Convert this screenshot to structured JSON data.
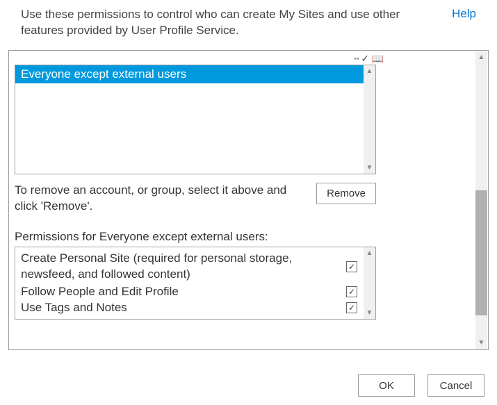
{
  "header": {
    "description": "Use these permissions to control who can create My Sites and use other features provided by User Profile Service.",
    "help_label": "Help"
  },
  "accounts": {
    "items": [
      "Everyone except external users"
    ],
    "selected_index": 0
  },
  "remove_section": {
    "instruction": "To remove an account, or group, select it above and click 'Remove'.",
    "button_label": "Remove"
  },
  "permissions": {
    "label": "Permissions for Everyone except external users:",
    "items": [
      {
        "label": "Create Personal Site (required for personal storage, newsfeed, and followed content)",
        "checked": true
      },
      {
        "label": "Follow People and Edit Profile",
        "checked": true
      },
      {
        "label": "Use Tags and Notes",
        "checked": true
      }
    ]
  },
  "footer": {
    "ok_label": "OK",
    "cancel_label": "Cancel"
  }
}
